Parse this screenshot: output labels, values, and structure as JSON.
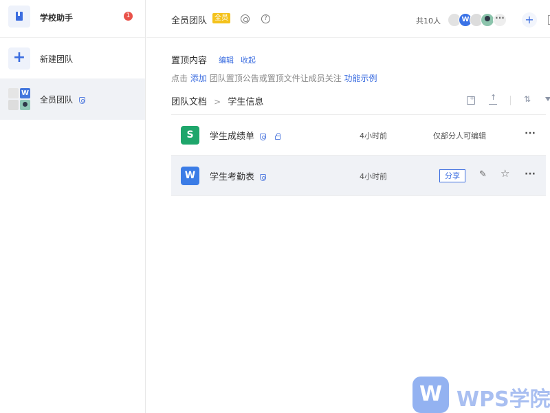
{
  "sidebar": {
    "app_name": "学校助手",
    "app_badge": "1",
    "new_team_label": "新建团队",
    "team_name": "全员团队",
    "team_avatar_letter": "W"
  },
  "header": {
    "team_title": "全员团队",
    "all_tag": "全员",
    "help_glyph": "?",
    "member_count": "共10人",
    "member_avatar_letter": "W",
    "more_members_glyph": "···",
    "add_glyph": "+"
  },
  "pinned": {
    "title": "置顶内容",
    "edit_label": "编辑",
    "collapse_label": "收起",
    "hint_prefix": "点击",
    "hint_add": "添加",
    "hint_middle": "团队置顶公告或置顶文件让成员关注",
    "hint_example": "功能示例"
  },
  "breadcrumb": {
    "root": "团队文档",
    "separator": ">",
    "current": "学生信息"
  },
  "toolbar": {
    "sort_glyph": "⇅"
  },
  "files": [
    {
      "name": "学生成绩单",
      "type_letter": "S",
      "time": "4小时前",
      "permission": "仅部分人可编辑",
      "more": "···"
    },
    {
      "name": "学生考勤表",
      "type_letter": "W",
      "time": "4小时前",
      "share_label": "分享",
      "edit_glyph": "✎",
      "star_glyph": "☆",
      "more": "···"
    }
  ],
  "watermark": {
    "text": "WPS学院"
  },
  "colors": {
    "accent": "#3b6de0",
    "sheet_green": "#1ea66b",
    "doc_blue": "#3b7ce6",
    "badge_red": "#e9524a",
    "tag_yellow": "#f4c21b",
    "selected_row": "#f0f2f6"
  }
}
